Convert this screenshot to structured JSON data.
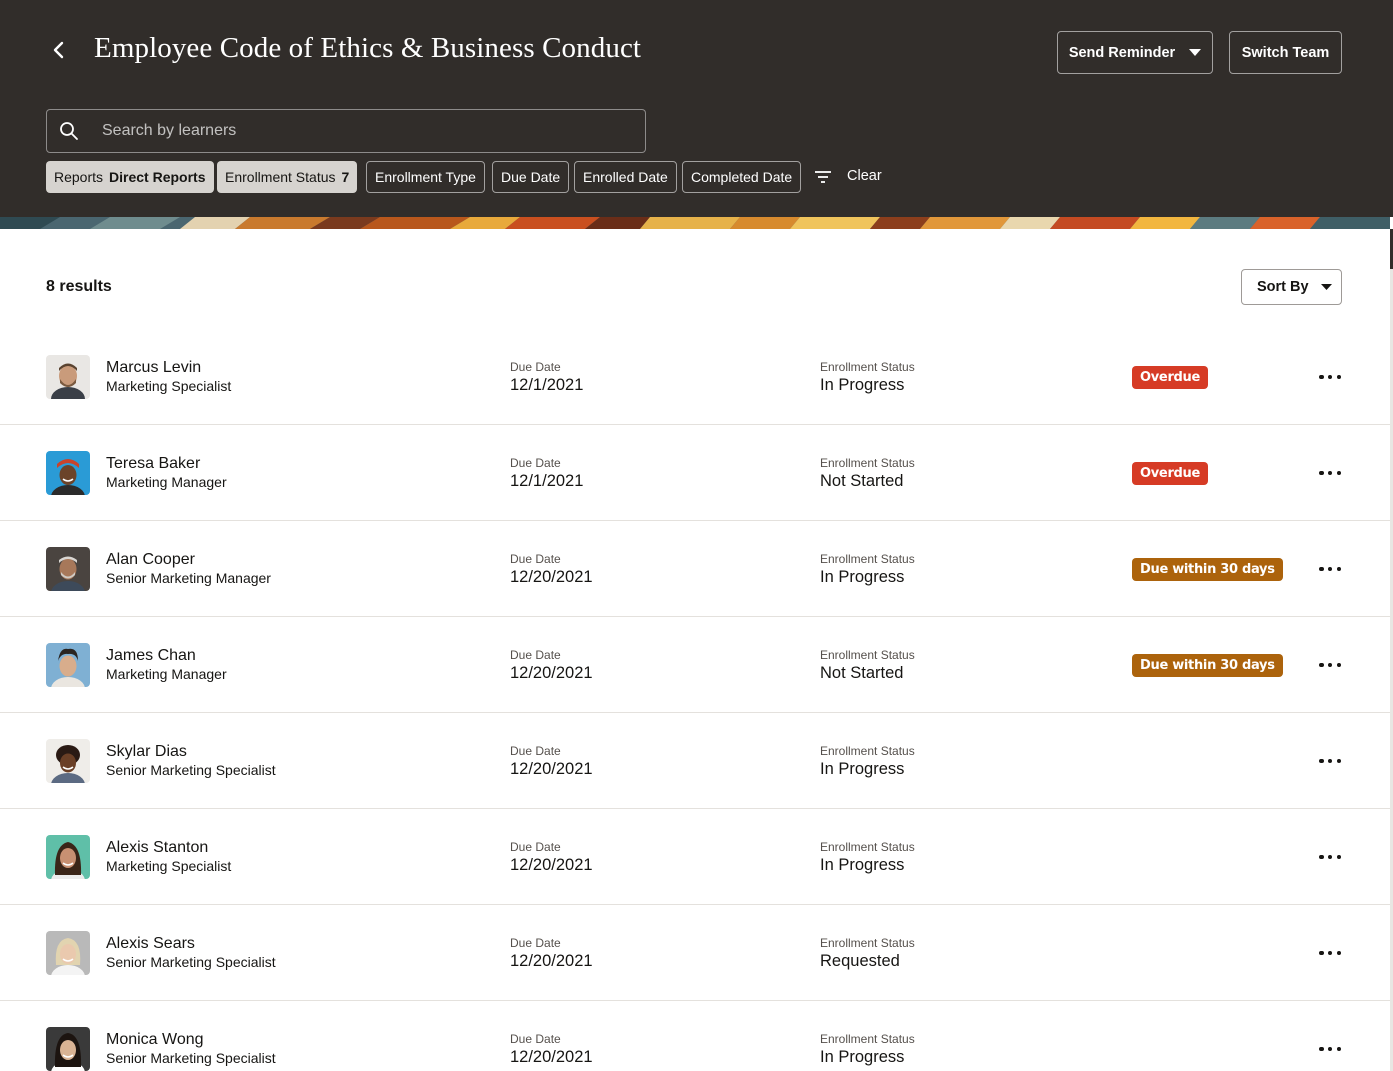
{
  "header": {
    "title": "Employee Code of Ethics & Business Conduct",
    "back_icon": "chevron-left-icon",
    "send_reminder_label": "Send Reminder",
    "switch_team_label": "Switch Team"
  },
  "search": {
    "placeholder": "Search by learners",
    "value": ""
  },
  "filters": [
    {
      "label": "Reports",
      "value": "Direct Reports"
    },
    {
      "label": "Enrollment Status",
      "value": "7"
    },
    {
      "label": "Enrollment Type"
    },
    {
      "label": "Due Date"
    },
    {
      "label": "Enrolled Date"
    },
    {
      "label": "Completed Date"
    }
  ],
  "filter_icon": "filter-icon",
  "clear_label": "Clear",
  "results": {
    "count_label": "8 results",
    "sort_label": "Sort By"
  },
  "columns": {
    "due_date": "Due Date",
    "enrollment_status": "Enrollment Status"
  },
  "learners": [
    {
      "name": "Marcus Levin",
      "role": "Marketing Specialist",
      "due_date": "12/1/2021",
      "status": "In Progress",
      "badge": "Overdue",
      "badge_type": "overdue"
    },
    {
      "name": "Teresa Baker",
      "role": "Marketing Manager",
      "due_date": "12/1/2021",
      "status": "Not Started",
      "badge": "Overdue",
      "badge_type": "overdue"
    },
    {
      "name": "Alan Cooper",
      "role": "Senior Marketing Manager",
      "due_date": "12/20/2021",
      "status": "In Progress",
      "badge": "Due within 30 days",
      "badge_type": "due-soon"
    },
    {
      "name": "James Chan",
      "role": "Marketing Manager",
      "due_date": "12/20/2021",
      "status": "Not Started",
      "badge": "Due within 30 days",
      "badge_type": "due-soon"
    },
    {
      "name": "Skylar Dias",
      "role": "Senior Marketing Specialist",
      "due_date": "12/20/2021",
      "status": "In Progress",
      "badge": "",
      "badge_type": ""
    },
    {
      "name": "Alexis Stanton",
      "role": "Marketing Specialist",
      "due_date": "12/20/2021",
      "status": "In Progress",
      "badge": "",
      "badge_type": ""
    },
    {
      "name": "Alexis Sears",
      "role": "Senior Marketing Specialist",
      "due_date": "12/20/2021",
      "status": "Requested",
      "badge": "",
      "badge_type": ""
    },
    {
      "name": "Monica Wong",
      "role": "Senior Marketing Specialist",
      "due_date": "12/20/2021",
      "status": "In Progress",
      "badge": "",
      "badge_type": ""
    }
  ],
  "colors": {
    "header_bg": "#312d2a",
    "overdue": "#d63b25",
    "due_soon": "#ac630c",
    "chip_filled": "#d6d3cf"
  }
}
